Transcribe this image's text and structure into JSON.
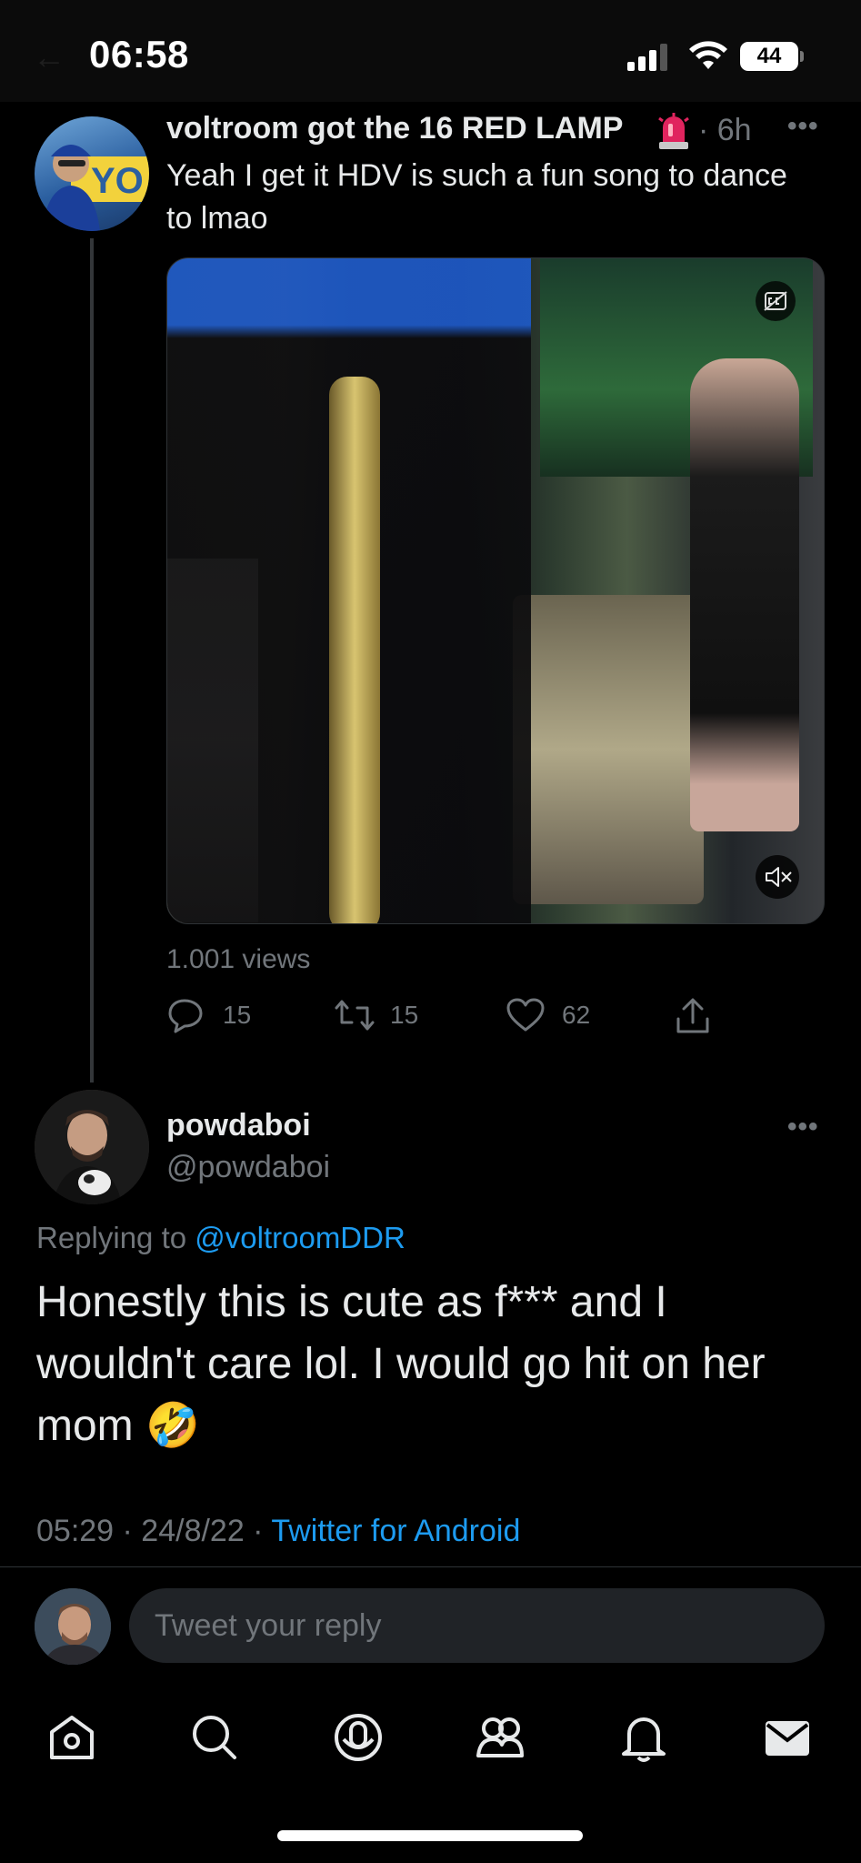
{
  "status_bar": {
    "time": "06:58",
    "battery": "44"
  },
  "tweet": {
    "author_name": "voltroom got the 16 RED LAMP",
    "age": "· 6h",
    "text": "Yeah I get it HDV is such a fun song to dance to lmao",
    "views": "1.001 views",
    "replies": "15",
    "retweets": "15",
    "likes": "62"
  },
  "reply": {
    "author_name": "powdaboi",
    "handle": "@powdaboi",
    "replying_prefix": "Replying to ",
    "replying_to": "@voltroomDDR",
    "text": "Honestly this is cute as f*** and I wouldn't care lol. I would go hit on her mom 🤣",
    "timestamp": "05:29 · 24/8/22 · ",
    "source": "Twitter for Android"
  },
  "composer": {
    "placeholder": "Tweet your reply"
  },
  "colors": {
    "background": "#000000",
    "text": "#e7e9ea",
    "muted": "#71767b",
    "accent": "#1d9bf0"
  },
  "icons": {
    "tabs": [
      "home-icon",
      "search-icon",
      "spaces-icon",
      "communities-icon",
      "notifications-icon",
      "messages-icon"
    ]
  }
}
